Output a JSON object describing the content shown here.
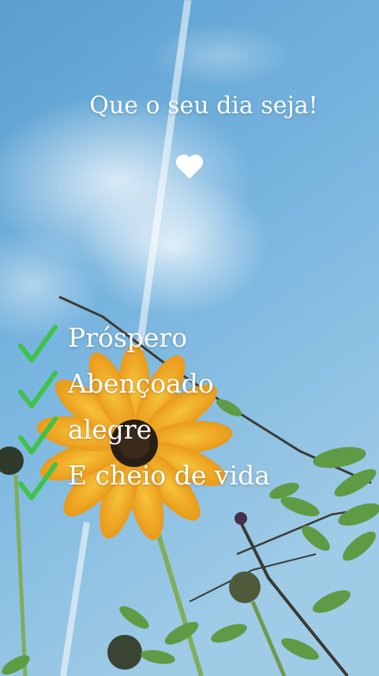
{
  "greeting": "Que o seu dia seja!",
  "icons": {
    "heart": "heart-icon",
    "check": "checkmark-icon"
  },
  "colors": {
    "sky": "#6fb0dc",
    "petal": "#f3b026",
    "check": "#3fc24a",
    "text": "#ffffff"
  },
  "wishes": [
    {
      "label": "Próspero"
    },
    {
      "label": "Abençoado"
    },
    {
      "label": "alegre"
    },
    {
      "label": "E cheio de vida"
    }
  ]
}
